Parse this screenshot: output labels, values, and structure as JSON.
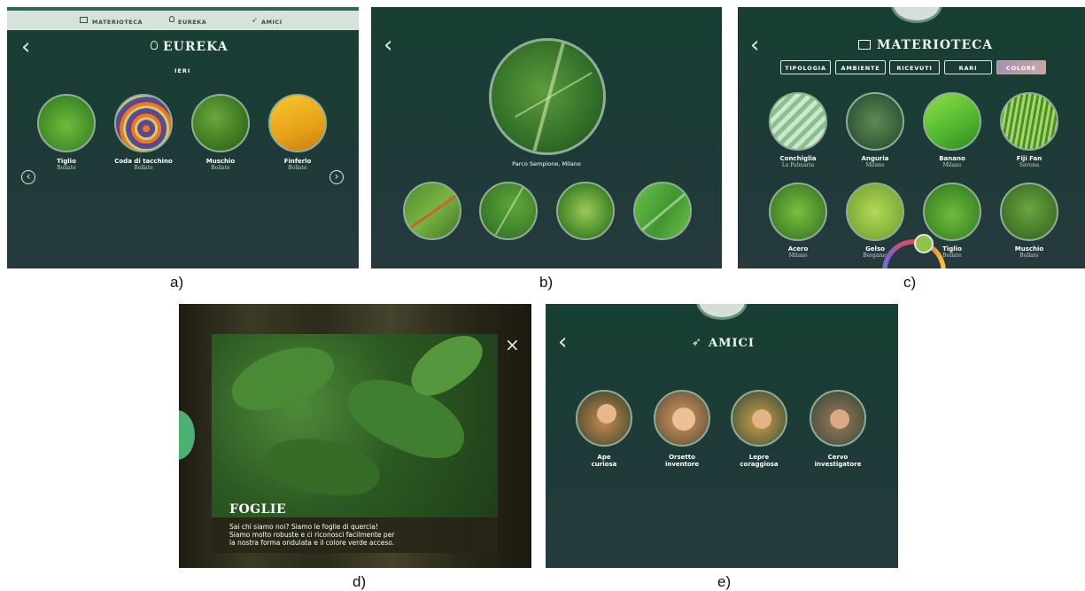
{
  "captions": {
    "a": "a)",
    "b": "b)",
    "c": "c)",
    "d": "d)",
    "e": "e)"
  },
  "panel_a": {
    "nav": [
      "MATERIOTECA",
      "EUREKA",
      "AMICI"
    ],
    "title": "EUREKA",
    "section": "IERI",
    "items": [
      {
        "name": "Tiglio",
        "place": "Bollate"
      },
      {
        "name": "Coda di tacchino",
        "place": "Bollate"
      },
      {
        "name": "Muschio",
        "place": "Bollate"
      },
      {
        "name": "Finferlo",
        "place": "Bollate"
      }
    ],
    "back_glyph": "‹",
    "prev_glyph": "‹",
    "next_glyph": "›"
  },
  "panel_b": {
    "back_glyph": "‹",
    "location": "Parco Sempione, Milano"
  },
  "panel_c": {
    "back_glyph": "‹",
    "title": "MATERIOTECA",
    "filters": [
      "TIPOLOGIA",
      "AMBIENTE",
      "RICEVUTI",
      "RARI",
      "COLORE"
    ],
    "items": [
      {
        "name": "Conchiglia",
        "place": "La Palmaria"
      },
      {
        "name": "Anguria",
        "place": "Milano"
      },
      {
        "name": "Banano",
        "place": "Milano"
      },
      {
        "name": "Fiji Fan",
        "place": "Savona"
      },
      {
        "name": "Acero",
        "place": "Milano"
      },
      {
        "name": "Gelso",
        "place": "Bergamo"
      },
      {
        "name": "Tiglio",
        "place": "Bollate"
      },
      {
        "name": "Muschio",
        "place": "Bollate"
      }
    ]
  },
  "panel_d": {
    "close_glyph": "×",
    "title": "FOGLIE",
    "text_lines": [
      "Sai chi siamo noi? Siamo le foglie di quercia!",
      "Siamo molto robuste e ci riconosci facilmente per",
      "la nostra forma ondulata e il colore verde acceso."
    ]
  },
  "panel_e": {
    "back_glyph": "‹",
    "title": "AMICI",
    "friends": [
      {
        "line1": "Ape",
        "line2": "curiosa"
      },
      {
        "line1": "Orsetto",
        "line2": "inventore"
      },
      {
        "line1": "Lepre",
        "line2": "coraggiosa"
      },
      {
        "line1": "Cervo",
        "line2": "investigatore"
      }
    ]
  },
  "colors": {
    "bg": "#1c3d36",
    "accent": "#c3d8c8",
    "filter_active": "#b79ab6"
  }
}
